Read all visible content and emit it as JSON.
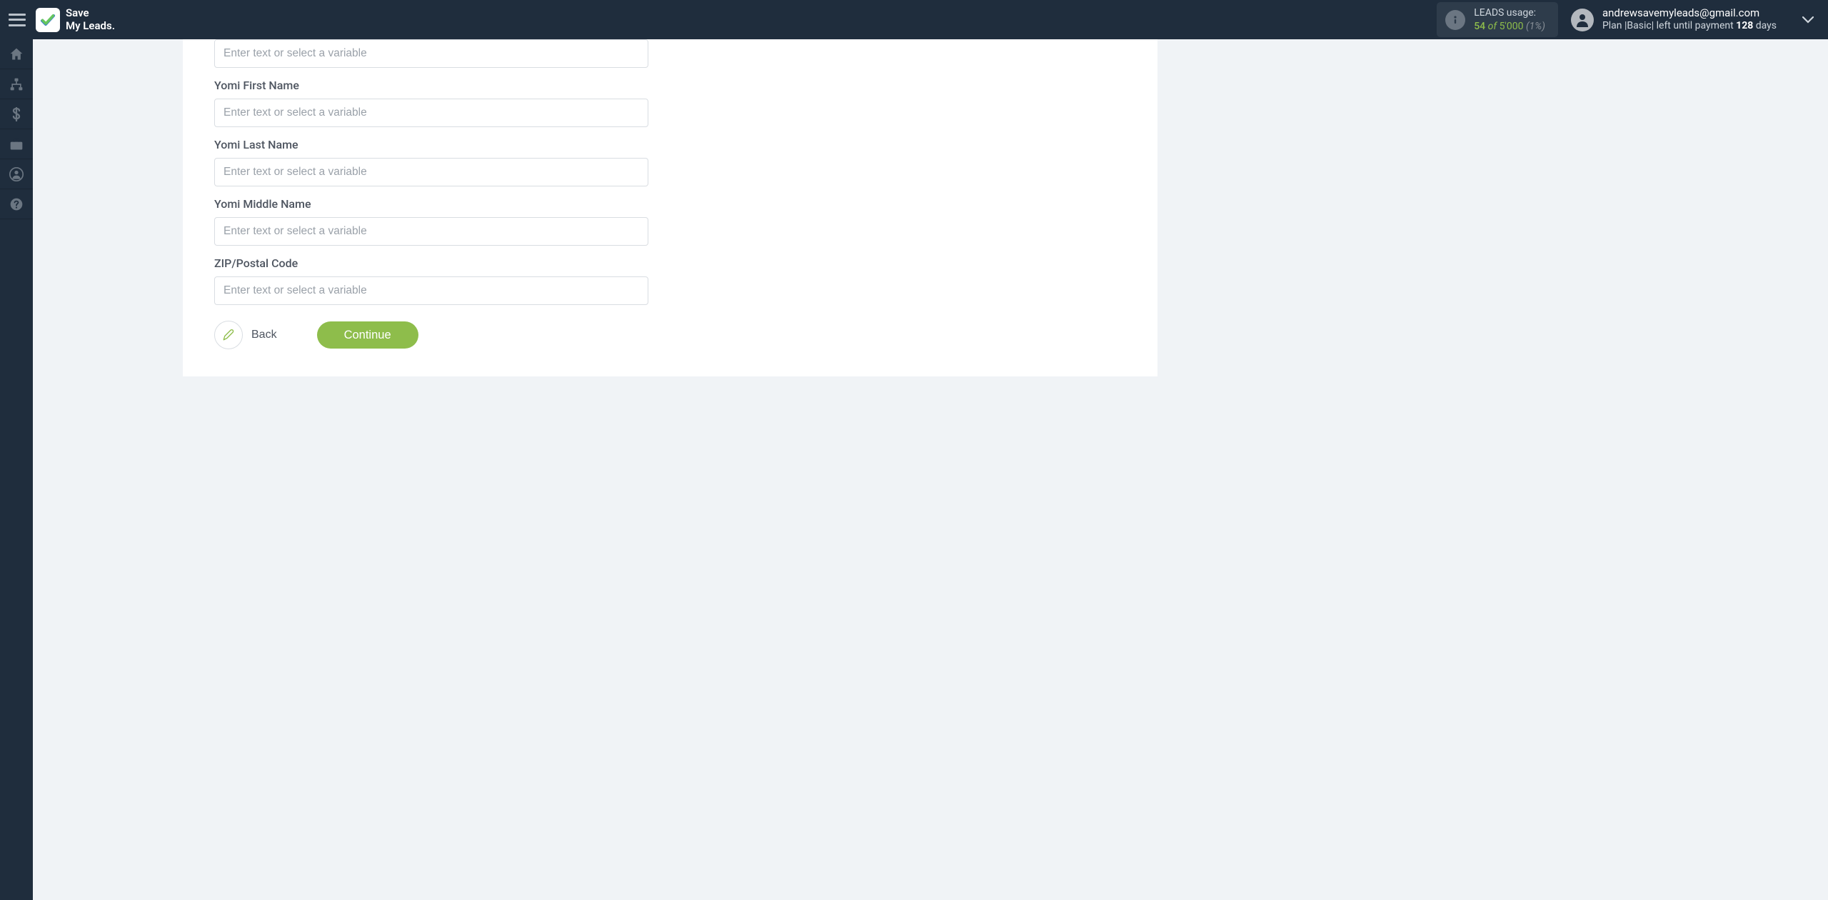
{
  "app": {
    "logo_line1": "Save",
    "logo_line2": "My Leads."
  },
  "usage": {
    "label": "LEADS usage:",
    "current": "54",
    "of": "of",
    "total": "5'000",
    "percent": "(1%)"
  },
  "account": {
    "email": "andrewsavemyleads@gmail.com",
    "plan_prefix": "Plan |",
    "plan_name": "Basic",
    "plan_mid": "| left until payment ",
    "days_count": "128",
    "days_suffix": " days"
  },
  "form": {
    "placeholder": "Enter text or select a variable",
    "fields": [
      {
        "label": ""
      },
      {
        "label": "Yomi First Name"
      },
      {
        "label": "Yomi Last Name"
      },
      {
        "label": "Yomi Middle Name"
      },
      {
        "label": "ZIP/Postal Code"
      }
    ],
    "back_label": "Back",
    "continue_label": "Continue"
  }
}
